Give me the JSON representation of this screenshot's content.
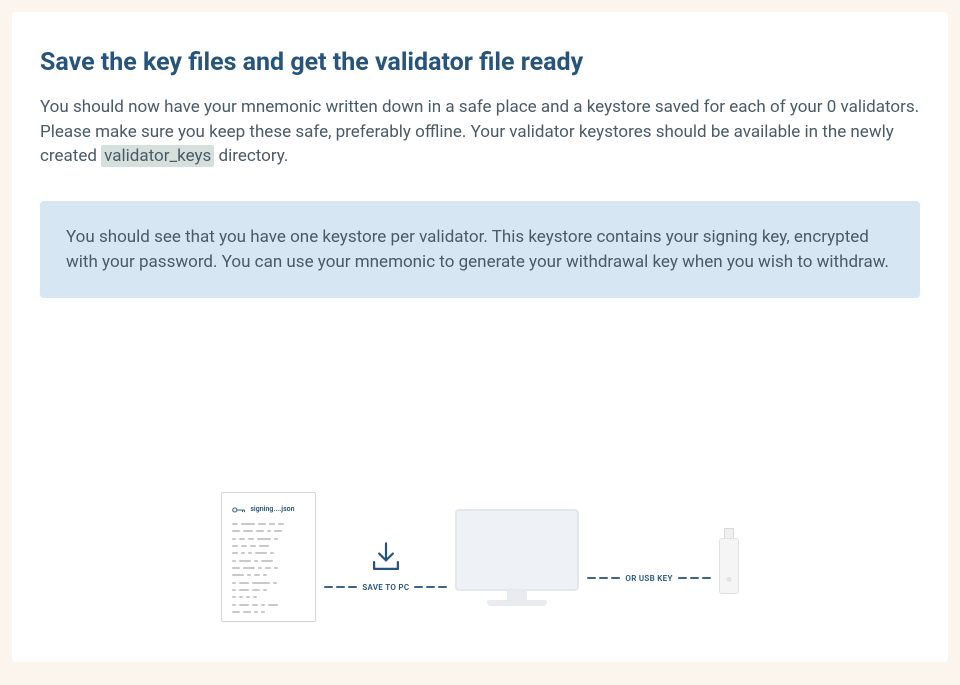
{
  "heading": "Save the key files and get the validator file ready",
  "paragraph": {
    "pre": "You should now have your mnemonic written down in a safe place and a keystore saved for each of your 0 validators. Please make sure you keep these safe, preferably offline. Your validator keystores should be available in the newly created ",
    "code": "validator_keys",
    "post": " directory."
  },
  "info_box": "You should see that you have one keystore per validator. This keystore contains your signing key, encrypted with your password. You can use your mnemonic to generate your withdrawal key when you wish to withdraw.",
  "illustration": {
    "doc_title": "signing....json",
    "save_to_pc": "SAVE TO PC",
    "or_usb": "OR USB KEY"
  },
  "colors": {
    "accent": "#26547c",
    "info_bg": "#d6e6f2",
    "page_bg": "#fcf5ed"
  }
}
